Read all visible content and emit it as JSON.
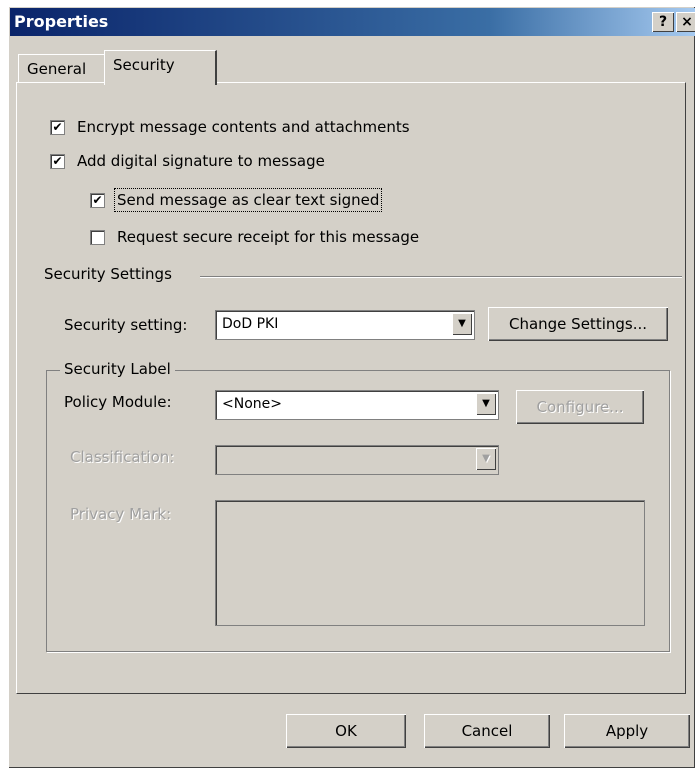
{
  "window": {
    "title": "Properties",
    "help_btn": "?",
    "close_btn": "×"
  },
  "tabs": [
    {
      "label": "General",
      "active": false
    },
    {
      "label": "Security",
      "active": true
    }
  ],
  "checkboxes": [
    {
      "label": "Encrypt message contents and attachments",
      "checked": true
    },
    {
      "label": "Add digital signature to message",
      "checked": true
    },
    {
      "label": "Send message as clear text signed",
      "checked": true
    },
    {
      "label": "Request secure receipt for this message",
      "checked": false
    }
  ],
  "security_settings": {
    "group_label": "Security Settings",
    "setting_label": "Security setting:",
    "setting_value": "DoD PKI",
    "change_btn": "Change Settings..."
  },
  "security_label": {
    "group_label": "Security Label",
    "policy_label": "Policy Module:",
    "policy_value": "<None>",
    "configure_btn": "Configure...",
    "classification_label": "Classification:",
    "classification_value": "",
    "privacy_label": "Privacy Mark:"
  },
  "footer": {
    "ok": "OK",
    "cancel": "Cancel",
    "apply": "Apply"
  }
}
